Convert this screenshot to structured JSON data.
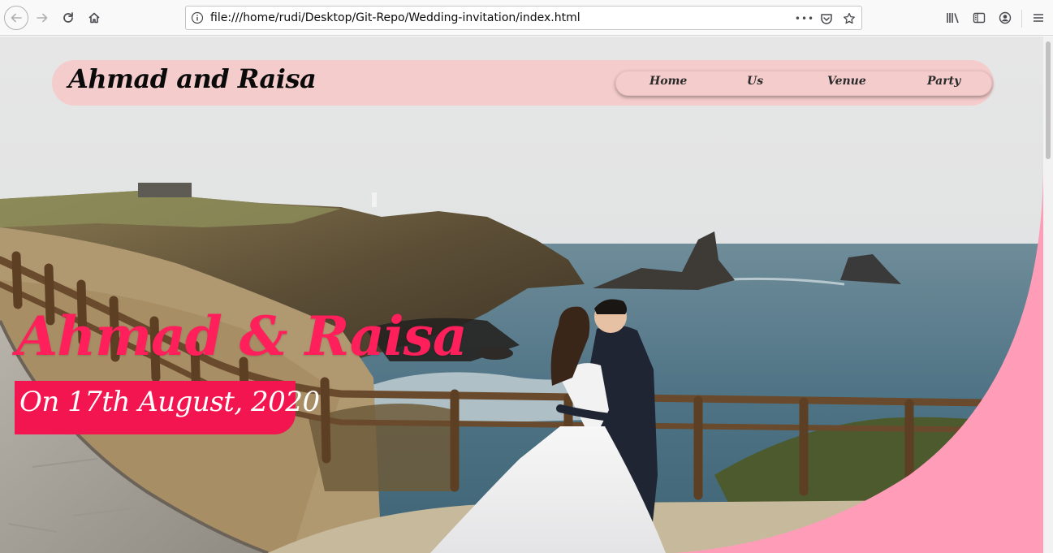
{
  "browser": {
    "url": "file:///home/rudi/Desktop/Git-Repo/Wedding-invitation/index.html",
    "page_actions_label": "•••"
  },
  "page": {
    "brand_title": "Ahmad and Raisa",
    "nav": [
      {
        "label": "Home"
      },
      {
        "label": "Us"
      },
      {
        "label": "Venue"
      },
      {
        "label": "Party"
      }
    ],
    "headline": "Ahmad & Raisa",
    "date_line": "On 17th August, 2020"
  },
  "colors": {
    "brand_pink": "#f5cccc",
    "headline_pink": "#ff1f5a",
    "banner_pink": "#f2154f",
    "curve_pink": "#ff9cb8"
  }
}
